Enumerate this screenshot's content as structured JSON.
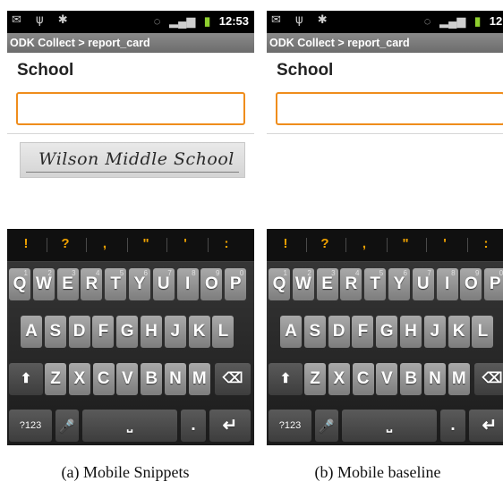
{
  "status_bar": {
    "time": "12:53",
    "left_icons": [
      "message-icon",
      "usb-icon",
      "android-icon"
    ],
    "right_icons": [
      "sync-icon",
      "signal-icon",
      "battery-icon"
    ]
  },
  "title_bar": {
    "title": "ODK Collect > report_card"
  },
  "form": {
    "question_label": "School",
    "answer_value": "",
    "snippet_text": "Wilson Middle School"
  },
  "keyboard": {
    "suggestions": [
      "!",
      "?",
      ",",
      "\"",
      "'",
      ":"
    ],
    "rows": [
      {
        "keys": [
          "Q",
          "W",
          "E",
          "R",
          "T",
          "Y",
          "U",
          "I",
          "O",
          "P"
        ],
        "hints": [
          "1",
          "2",
          "3",
          "4",
          "5",
          "6",
          "7",
          "8",
          "9",
          "0"
        ]
      },
      {
        "keys": [
          "A",
          "S",
          "D",
          "F",
          "G",
          "H",
          "J",
          "K",
          "L"
        ]
      },
      {
        "keys": [
          "Z",
          "X",
          "C",
          "V",
          "B",
          "N",
          "M"
        ]
      }
    ],
    "shift_glyph": "⬆",
    "backspace_glyph": "⌫",
    "symbols_label": "?123",
    "mic_glyph": "🎤",
    "space_glyph": "⎵",
    "period_label": ".",
    "enter_glyph": "↵"
  },
  "captions": {
    "a": "(a) Mobile Snippets",
    "b": "(b) Mobile baseline"
  },
  "colors": {
    "input_border": "#ef8d1c",
    "suggestion": "#f2a300",
    "title_bar": "#7a7a7a"
  }
}
